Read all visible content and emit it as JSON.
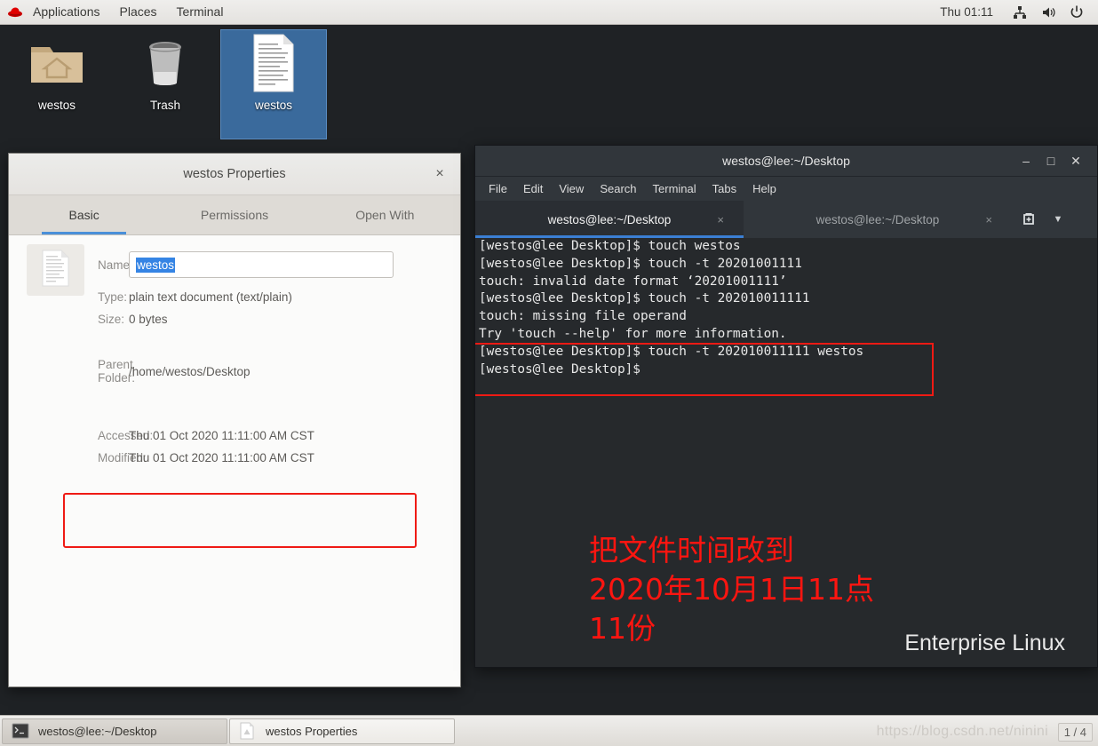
{
  "top_panel": {
    "logo_icon": "redhat-logo-icon",
    "menus": [
      "Applications",
      "Places",
      "Terminal"
    ],
    "clock": "Thu 01:11",
    "tray_icons": [
      "network-icon",
      "volume-icon",
      "power-icon"
    ]
  },
  "desktop": {
    "icons": [
      {
        "label": "westos",
        "icon": "home-folder-icon",
        "selected": false
      },
      {
        "label": "Trash",
        "icon": "trash-icon",
        "selected": false
      },
      {
        "label": "westos",
        "icon": "text-document-icon",
        "selected": true
      }
    ]
  },
  "properties_dialog": {
    "title": "westos Properties",
    "close_label": "×",
    "tabs": [
      {
        "label": "Basic",
        "active": true
      },
      {
        "label": "Permissions",
        "active": false
      },
      {
        "label": "Open With",
        "active": false
      }
    ],
    "file_icon": "text-document-icon",
    "fields": {
      "name_label": "Name:",
      "name_value": "westos",
      "type_label": "Type:",
      "type_value": "plain text document (text/plain)",
      "size_label": "Size:",
      "size_value": "0 bytes",
      "parent_label": "Parent Folder:",
      "parent_value": "/home/westos/Desktop",
      "accessed_label": "Accessed:",
      "accessed_value": "Thu 01 Oct 2020 11:11:00 AM CST",
      "modified_label": "Modified:",
      "modified_value": "Thu 01 Oct 2020 11:11:00 AM CST"
    },
    "highlight_color": "#ef1a14",
    "accent_color": "#4a90d9"
  },
  "terminal": {
    "title": "westos@lee:~/Desktop",
    "window_buttons": {
      "minimize": "–",
      "maximize": "□",
      "close": "✕"
    },
    "menus": [
      "File",
      "Edit",
      "View",
      "Search",
      "Terminal",
      "Tabs",
      "Help"
    ],
    "tabs": [
      {
        "label": "westos@lee:~/Desktop",
        "active": true,
        "close": "×"
      },
      {
        "label": "westos@lee:~/Desktop",
        "active": false,
        "close": "×"
      }
    ],
    "new_tab_icon": "new-tab-icon",
    "tab_menu_icon": "chevron-down-icon",
    "lines": [
      "[westos@lee Desktop]$ touch westos",
      "[westos@lee Desktop]$ touch -t 20201001111",
      "touch: invalid date format ‘20201001111’",
      "[westos@lee Desktop]$ touch -t 202010011111",
      "touch: missing file operand",
      "Try 'touch --help' for more information.",
      "[westos@lee Desktop]$ touch -t 202010011111 westos",
      "[westos@lee Desktop]$ "
    ],
    "annotation": "把文件时间改到\n2020年10月1日11点\n11份",
    "annotation_color": "#ff1510",
    "brand_text": "Enterprise Linux"
  },
  "taskbar": {
    "buttons": [
      {
        "label": "westos@lee:~/Desktop",
        "icon": "terminal-icon",
        "active": true
      },
      {
        "label": "westos Properties",
        "icon": "text-document-icon",
        "active": false
      }
    ],
    "watermark": "https://blog.csdn.net/ninini",
    "page_indicator": "1 / 4"
  }
}
